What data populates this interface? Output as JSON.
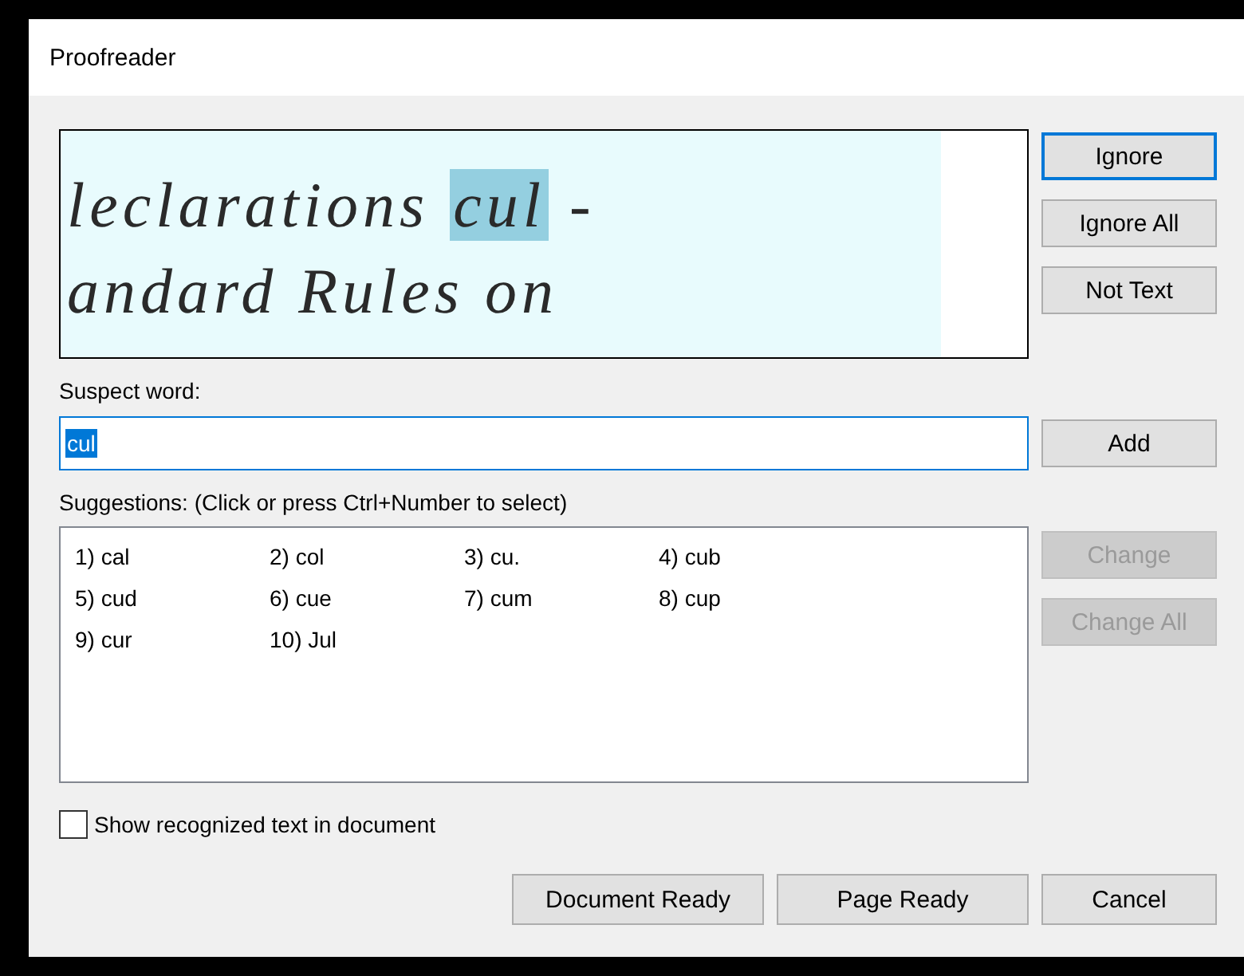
{
  "window": {
    "title": "Proofreader"
  },
  "preview": {
    "lines": [
      {
        "before": "leclarations ",
        "highlight": "cul",
        "after": " -"
      },
      {
        "before": "andard Rules on"
      }
    ]
  },
  "side_buttons": [
    {
      "label": "Ignore",
      "focused": true,
      "disabled": false
    },
    {
      "label": "Ignore All",
      "focused": false,
      "disabled": false
    },
    {
      "label": "Not Text",
      "focused": false,
      "disabled": false
    }
  ],
  "suspect": {
    "label": "Suspect word:",
    "value": "cul",
    "value_selected": true,
    "button": {
      "label": "Add",
      "focused": false,
      "disabled": false
    }
  },
  "suggestions": {
    "label": "Suggestions: (Click or press Ctrl+Number to select)",
    "items": [
      "1) cal",
      "2) col",
      "3) cu.",
      "4) cub",
      "5) cud",
      "6) cue",
      "7) cum",
      "8) cup",
      "9) cur",
      "10) Jul"
    ],
    "buttons": [
      {
        "label": "Change",
        "focused": false,
        "disabled": true
      },
      {
        "label": "Change All",
        "focused": false,
        "disabled": true
      }
    ]
  },
  "show_recognized": {
    "label": "Show recognized text in document",
    "checked": false
  },
  "footer_buttons": [
    {
      "label": "Document Ready",
      "focused": false,
      "disabled": false
    },
    {
      "label": "Page Ready",
      "focused": false,
      "disabled": false
    },
    {
      "label": "Cancel",
      "focused": false,
      "disabled": false
    }
  ]
}
